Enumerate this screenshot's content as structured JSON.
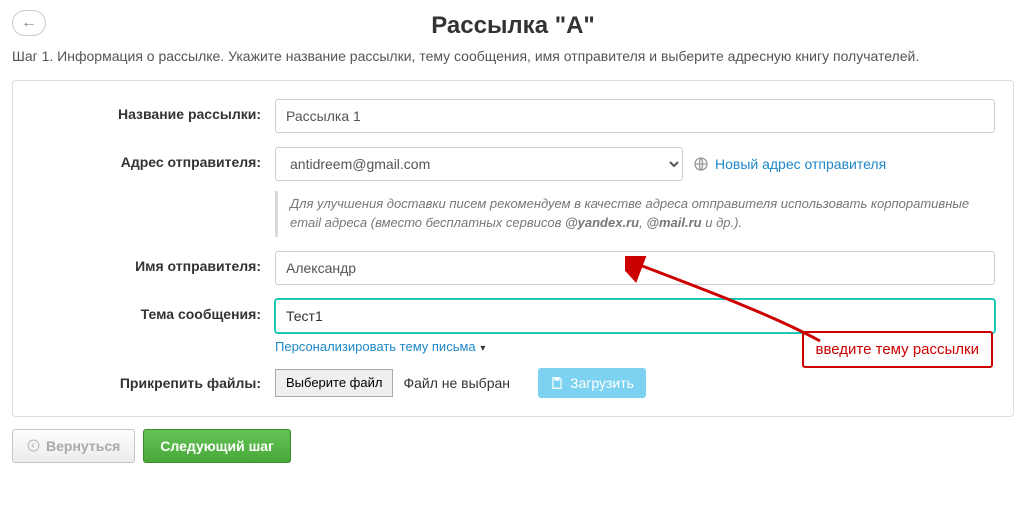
{
  "header": {
    "title": "Рассылка \"А\"",
    "step_desc": "Шаг 1. Информация о рассылке. Укажите название рассылки, тему сообщения, имя отправителя и выберите адресную книгу получателей."
  },
  "form": {
    "name_label": "Название рассылки:",
    "name_value": "Рассылка 1",
    "sender_addr_label": "Адрес отправителя:",
    "sender_addr_value": "antidreem@gmail.com",
    "new_addr_link": "Новый адрес отправителя",
    "hint_prefix": "Для улучшения доставки писем рекомендуем в качестве адреса отправителя использовать корпоративные email адреса (вместо бесплатных сервисов ",
    "hint_ex1": "@yandex.ru",
    "hint_sep": ", ",
    "hint_ex2": "@mail.ru",
    "hint_suffix": " и др.).",
    "sender_name_label": "Имя отправителя:",
    "sender_name_value": "Александр",
    "subject_label": "Тема сообщения:",
    "subject_value": "Тест1",
    "personalize_link": "Персонализировать тему письма",
    "attach_label": "Прикрепить файлы:",
    "choose_file": "Выберите файл",
    "no_file": "Файл не выбран",
    "upload": "Загрузить"
  },
  "buttons": {
    "back": "Вернуться",
    "next": "Следующий шаг"
  },
  "annotation": {
    "text": "введите тему рассылки"
  }
}
